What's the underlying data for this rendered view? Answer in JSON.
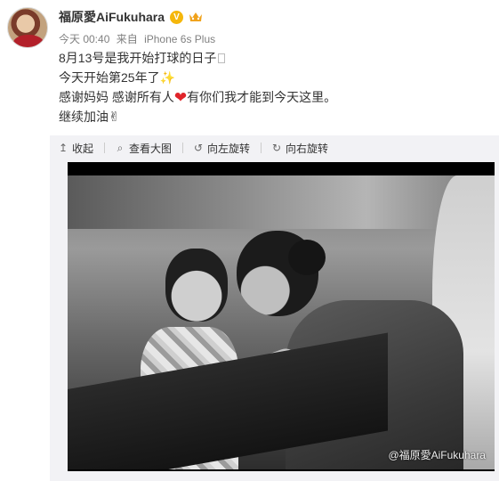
{
  "post": {
    "username": "福原愛AiFukuhara",
    "verified_badge": "V",
    "meta": {
      "time": "今天 00:40",
      "source_prefix": "来自",
      "device": "iPhone 6s Plus"
    },
    "lines": [
      "8月13号是我开始打球的日子",
      "今天开始第25年了",
      "感谢妈妈 感谢所有人",
      "有你们我才能到今天这里。",
      "继续加油"
    ],
    "icons": {
      "sparkle": "✨",
      "heart": "❤",
      "peace": "✌"
    }
  },
  "toolbar": {
    "collapse": "收起",
    "view_large": "查看大图",
    "rotate_left": "向左旋转",
    "rotate_right": "向右旋转"
  },
  "photo": {
    "watermark": "@福原愛AiFukuhara"
  },
  "colors": {
    "verified_badge": "#f5b70b",
    "heart": "#e0242a",
    "meta_text": "#808080",
    "toolbar_bg": "#f2f2f5"
  }
}
